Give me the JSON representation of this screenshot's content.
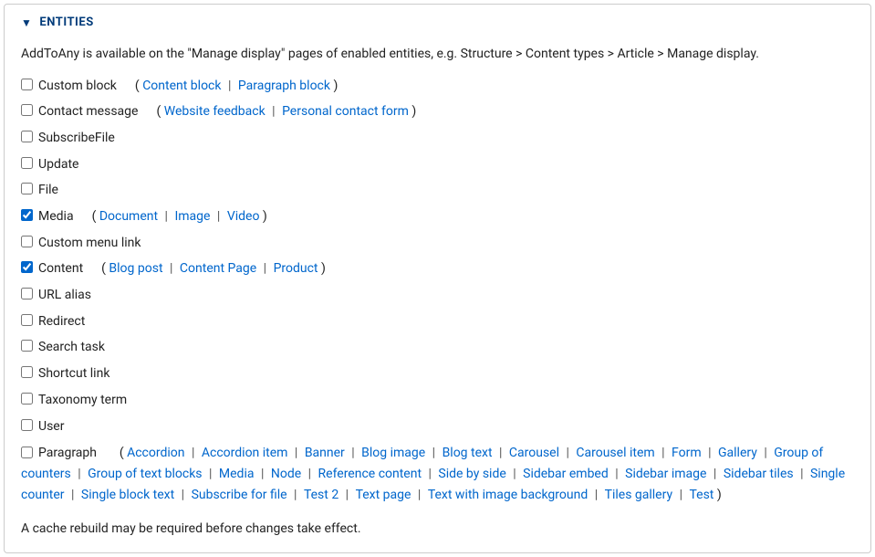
{
  "legend": "ENTITIES",
  "description": "AddToAny is available on the \"Manage display\" pages of enabled entities, e.g. Structure > Content types > Article > Manage display.",
  "entities": [
    {
      "id": "custom-block",
      "label": "Custom block",
      "checked": false,
      "bundles": [
        "Content block",
        "Paragraph block"
      ]
    },
    {
      "id": "contact-message",
      "label": "Contact message",
      "checked": false,
      "bundles": [
        "Website feedback",
        "Personal contact form"
      ]
    },
    {
      "id": "subscribefile",
      "label": "SubscribeFile",
      "checked": false,
      "bundles": []
    },
    {
      "id": "update",
      "label": "Update",
      "checked": false,
      "bundles": []
    },
    {
      "id": "file",
      "label": "File",
      "checked": false,
      "bundles": []
    },
    {
      "id": "media",
      "label": "Media",
      "checked": true,
      "bundles": [
        "Document",
        "Image",
        "Video"
      ]
    },
    {
      "id": "custom-menu-link",
      "label": "Custom menu link",
      "checked": false,
      "bundles": []
    },
    {
      "id": "content",
      "label": "Content",
      "checked": true,
      "bundles": [
        "Blog post",
        "Content Page",
        "Product"
      ]
    },
    {
      "id": "url-alias",
      "label": "URL alias",
      "checked": false,
      "bundles": []
    },
    {
      "id": "redirect",
      "label": "Redirect",
      "checked": false,
      "bundles": []
    },
    {
      "id": "search-task",
      "label": "Search task",
      "checked": false,
      "bundles": []
    },
    {
      "id": "shortcut-link",
      "label": "Shortcut link",
      "checked": false,
      "bundles": []
    },
    {
      "id": "taxonomy-term",
      "label": "Taxonomy term",
      "checked": false,
      "bundles": []
    },
    {
      "id": "user",
      "label": "User",
      "checked": false,
      "bundles": []
    },
    {
      "id": "paragraph",
      "label": "Paragraph",
      "checked": false,
      "bundles": [
        "Accordion",
        "Accordion item",
        "Banner",
        "Blog image",
        "Blog text",
        "Carousel",
        "Carousel item",
        "Form",
        "Gallery",
        "Group of counters",
        "Group of text blocks",
        "Media",
        "Node",
        "Reference content",
        "Side by side",
        "Sidebar embed",
        "Sidebar image",
        "Sidebar tiles",
        "Single counter",
        "Single block text",
        "Subscribe for file",
        "Test 2",
        "Text page",
        "Text with image background",
        "Tiles gallery",
        "Test"
      ]
    }
  ],
  "footer": "A cache rebuild may be required before changes take effect."
}
